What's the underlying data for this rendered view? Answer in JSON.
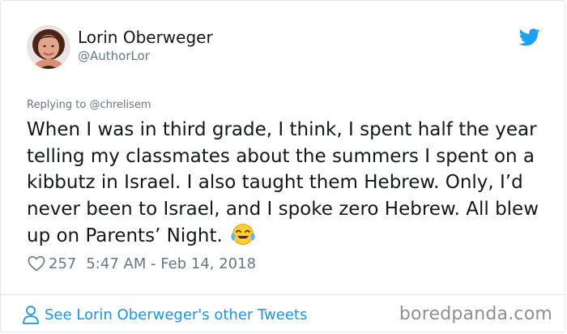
{
  "author": {
    "display_name": "Lorin Oberweger",
    "handle": "@AuthorLor",
    "avatar": "avatar-photo"
  },
  "reply": {
    "prefix": "Replying to",
    "mention": "@chrelisem"
  },
  "tweet": {
    "text": "When I was in third grade, I think, I spent half the year telling my classmates about the summers I spent on a kibbutz in Israel. I also taught them Hebrew. Only, I’d never been to Israel, and I spoke zero Hebrew. All blew up on Parents’ Night.",
    "emoji": "face-with-tears-of-joy"
  },
  "meta": {
    "like_count": "257",
    "timestamp": "5:47 AM - Feb 14, 2018"
  },
  "footer": {
    "see_more_label": "See Lorin Oberweger's other Tweets"
  },
  "watermark": "boredpanda.com",
  "colors": {
    "twitter_blue": "#1da1f2",
    "link_blue": "#1b95e0",
    "secondary_text": "#657786",
    "primary_text": "#14171a",
    "border": "#e1e8ed"
  },
  "icons": {
    "brand": "twitter-bird-icon",
    "like": "heart-icon",
    "profile": "person-icon"
  }
}
